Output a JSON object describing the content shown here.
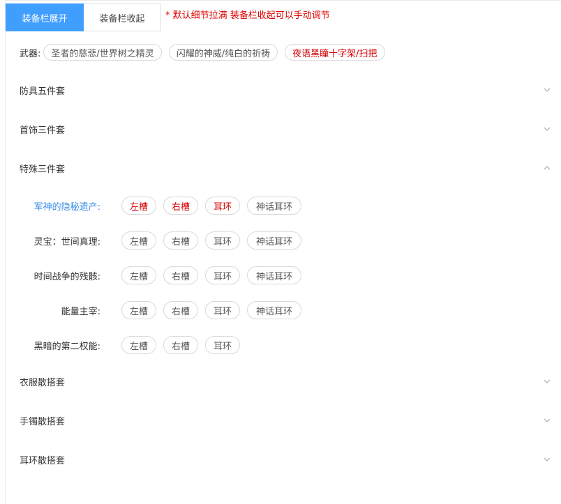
{
  "tabs": {
    "expand_label": "装备栏展开",
    "collapse_label": "装备栏收起",
    "note": "* 默认细节拉满 装备栏收起可以手动调节"
  },
  "weapon": {
    "label": "武器:",
    "options": [
      {
        "text": "圣者的慈悲/世界树之精灵",
        "color": "normal"
      },
      {
        "text": "闪耀的神威/纯白的祈祷",
        "color": "normal"
      },
      {
        "text": "夜语黑瞳十字架/扫把",
        "color": "red"
      }
    ]
  },
  "sections": {
    "armor": {
      "title": "防具五件套",
      "expanded": false
    },
    "accessory": {
      "title": "首饰三件套",
      "expanded": false
    },
    "special": {
      "title": "特殊三件套",
      "expanded": true
    },
    "clothes": {
      "title": "衣服散搭套",
      "expanded": false
    },
    "bracelet": {
      "title": "手镯散搭套",
      "expanded": false
    },
    "earring": {
      "title": "耳环散搭套",
      "expanded": false
    }
  },
  "special_sets": [
    {
      "label": "军神的隐秘遗产:",
      "label_color": "blue",
      "slots": [
        {
          "text": "左槽",
          "color": "red"
        },
        {
          "text": "右槽",
          "color": "red"
        },
        {
          "text": "耳环",
          "color": "red"
        },
        {
          "text": "神话耳环",
          "color": "normal"
        }
      ]
    },
    {
      "label": "灵宝：世间真理:",
      "label_color": "normal",
      "slots": [
        {
          "text": "左槽",
          "color": "normal"
        },
        {
          "text": "右槽",
          "color": "normal"
        },
        {
          "text": "耳环",
          "color": "normal"
        },
        {
          "text": "神话耳环",
          "color": "normal"
        }
      ]
    },
    {
      "label": "时间战争的残骸:",
      "label_color": "normal",
      "slots": [
        {
          "text": "左槽",
          "color": "normal"
        },
        {
          "text": "右槽",
          "color": "normal"
        },
        {
          "text": "耳环",
          "color": "normal"
        },
        {
          "text": "神话耳环",
          "color": "normal"
        }
      ]
    },
    {
      "label": "能量主宰:",
      "label_color": "normal",
      "slots": [
        {
          "text": "左槽",
          "color": "normal"
        },
        {
          "text": "右槽",
          "color": "normal"
        },
        {
          "text": "耳环",
          "color": "normal"
        },
        {
          "text": "神话耳环",
          "color": "normal"
        }
      ]
    },
    {
      "label": "黑暗的第二权能:",
      "label_color": "normal",
      "slots": [
        {
          "text": "左槽",
          "color": "normal"
        },
        {
          "text": "右槽",
          "color": "normal"
        },
        {
          "text": "耳环",
          "color": "normal"
        }
      ]
    }
  ],
  "colors": {
    "accent": "#409eff",
    "red": "#d40000",
    "blue_label": "#3a8ee6"
  }
}
